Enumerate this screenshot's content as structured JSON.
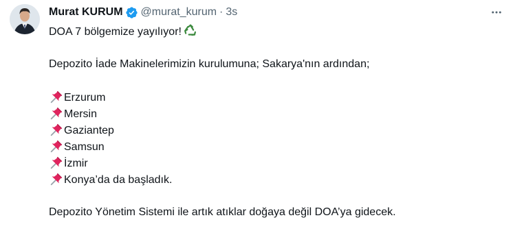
{
  "tweet": {
    "display_name": "Murat KURUM",
    "handle": "@murat_kurum",
    "separator": "·",
    "time": "3s",
    "icons": {
      "verified": "verified-badge-icon",
      "more": "more-options-icon",
      "pin": "pushpin-icon",
      "recycle": "recycling-icon"
    },
    "colors": {
      "verified": "#1d9bf0",
      "pin": "#e0245e",
      "recycle": "#3c8a3e",
      "secondary_text": "#536471"
    },
    "text": {
      "line1": "DOA 7 bölgemize yayılıyor!",
      "line2": "Depozito İade Makinelerimizin kurulumuna; Sakarya'nın ardından;",
      "cities": [
        "Erzurum",
        "Mersin",
        "Gaziantep",
        "Samsun",
        "İzmir",
        "Konya’da da başladık."
      ],
      "closing": "Depozito Yönetim Sistemi ile artık atıklar doğaya değil DOA’ya gidecek."
    }
  }
}
